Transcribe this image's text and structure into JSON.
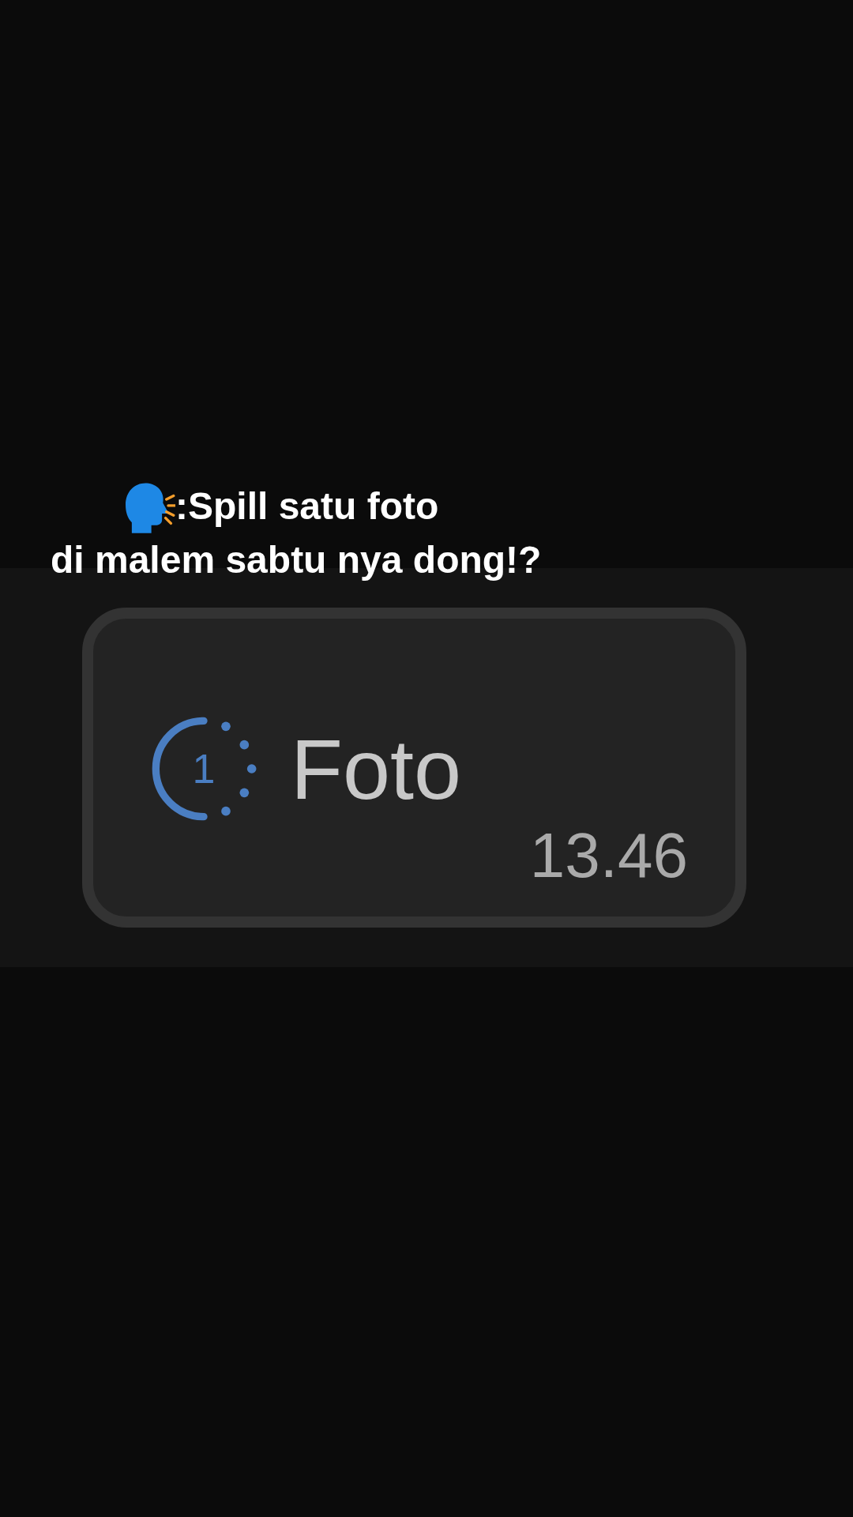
{
  "caption": {
    "line_1": ":Spill satu foto",
    "line_2": "di malem sabtu nya dong!?"
  },
  "message": {
    "view_once_count": "1",
    "label": "Foto",
    "time": "13.46"
  }
}
